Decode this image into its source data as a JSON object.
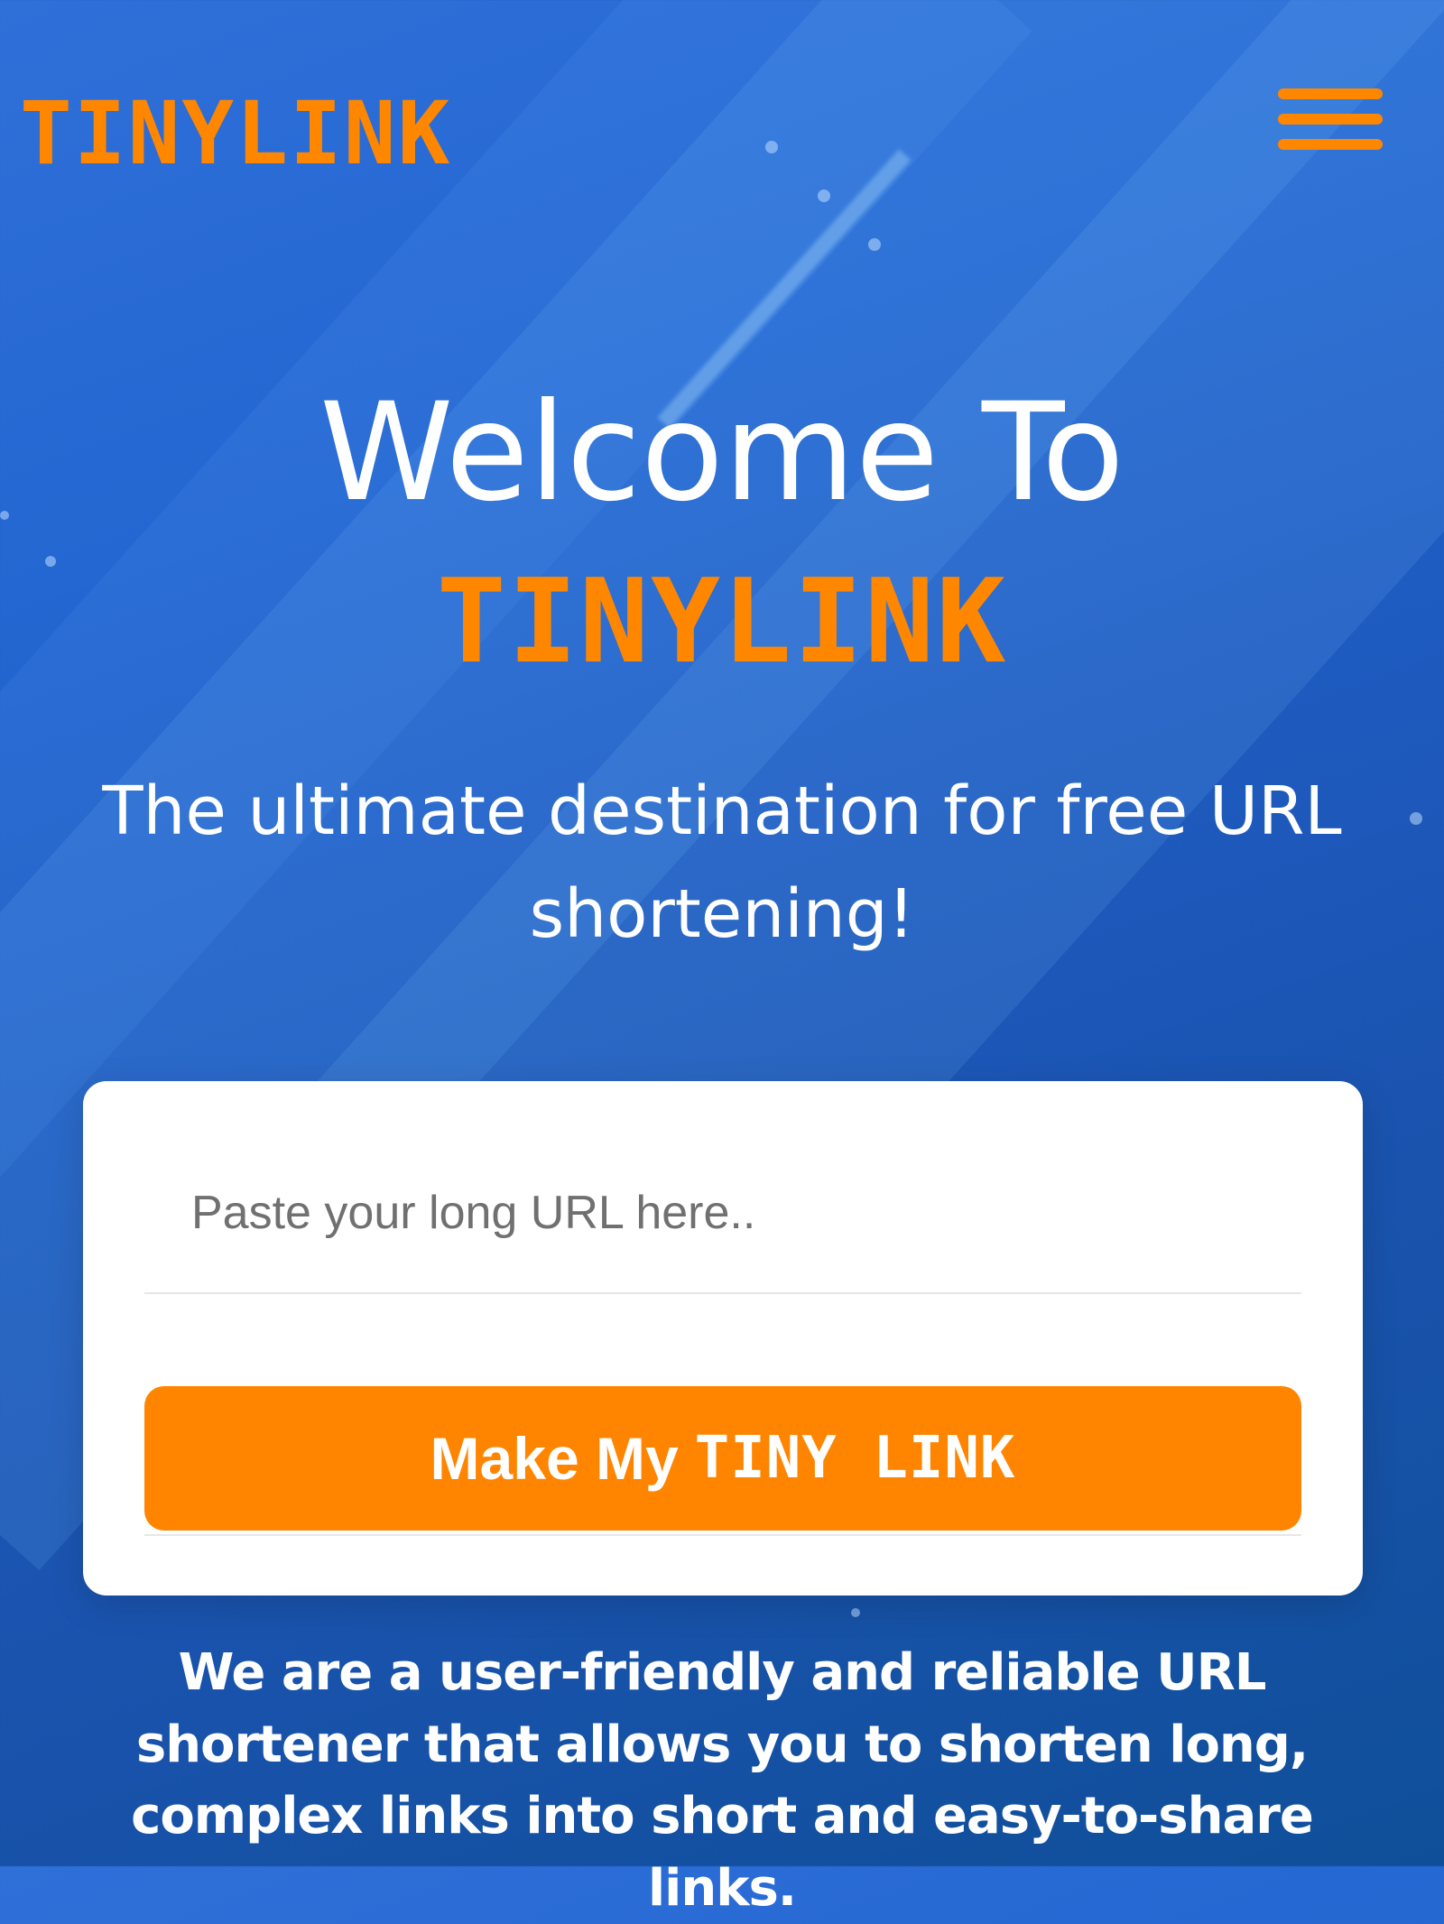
{
  "header": {
    "logo": "TINYLINK",
    "menu_icon": "hamburger-menu-icon"
  },
  "hero": {
    "welcome": "Welcome To",
    "brand": "TINYLINK",
    "tagline": "The ultimate destination for free URL shortening!"
  },
  "shortener": {
    "url_placeholder": "Paste your long URL here..",
    "button_prefix": "Make My",
    "button_brand": "TINY LINK"
  },
  "description": "We are a user-friendly and reliable URL shortener that allows you to shorten long, complex links into short and easy-to-share links.",
  "colors": {
    "accent": "#ff8700",
    "background_blue": "#1f5cc2",
    "card": "#ffffff",
    "text": "#ffffff"
  }
}
